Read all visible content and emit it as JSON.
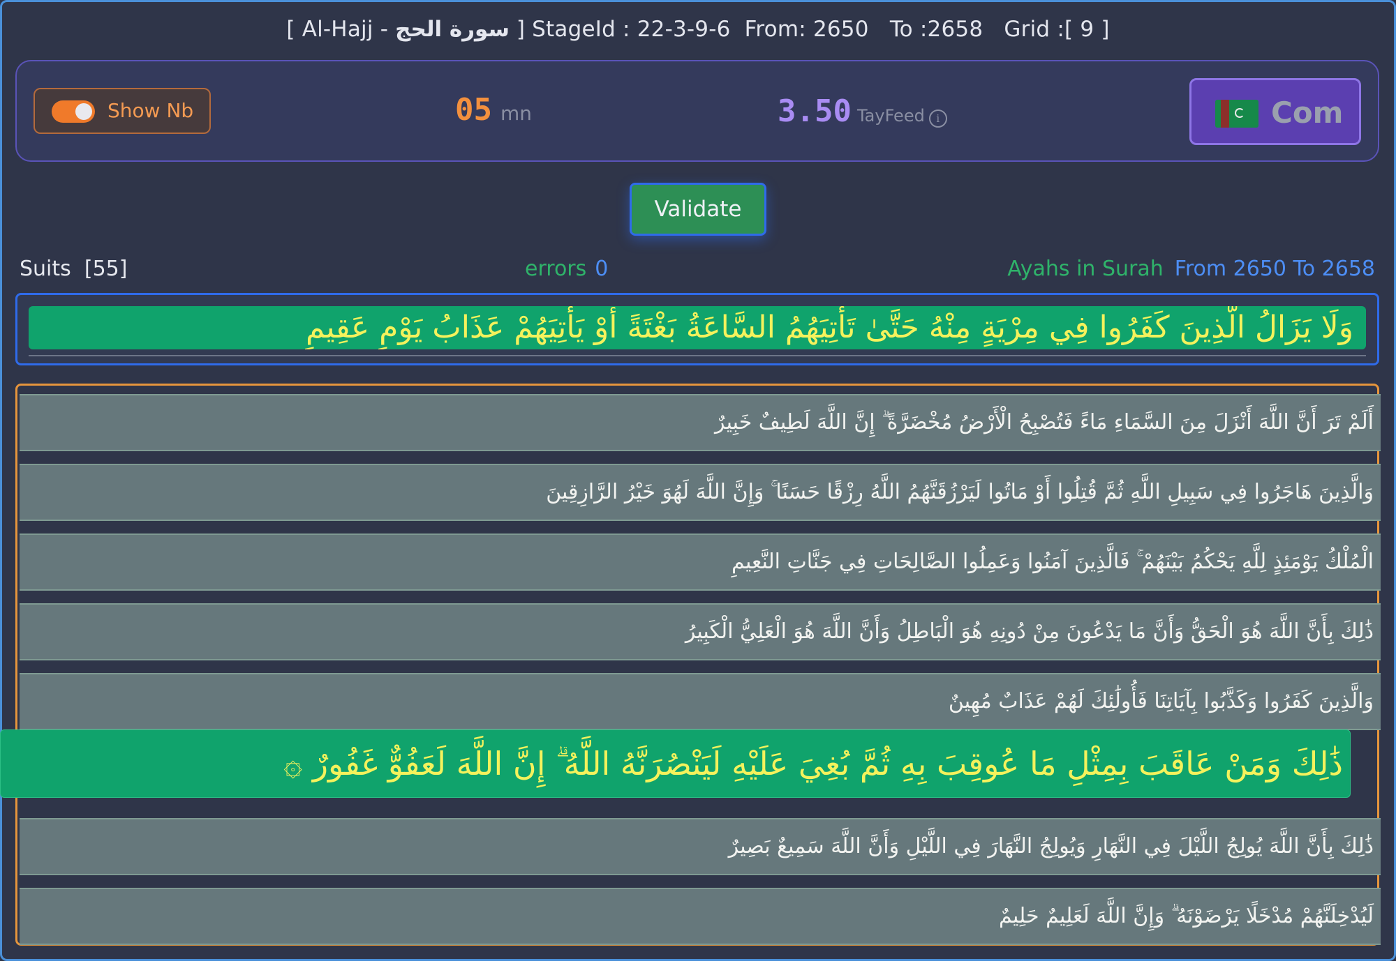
{
  "header": {
    "surah_latin": "Al-Hajj",
    "surah_arabic": "سورة الحج",
    "stage_label": "StageId :",
    "stage_id": "22-3-9-6",
    "from_label": "From:",
    "from_value": "2650",
    "to_label": "To :",
    "to_value": "2658",
    "grid_label": "Grid :[",
    "grid_value": "9"
  },
  "panel": {
    "toggle_label": "Show Nb",
    "toggle_on": true,
    "minutes_value": "05",
    "minutes_unit": "mn",
    "tayfeed_value": "3.50",
    "tayfeed_unit": "TayFeed",
    "info_icon": "i",
    "com_label": "Com",
    "flag_icon": "turkmenistan-flag-icon"
  },
  "validate_label": "Validate",
  "stats": {
    "suits_label": "Suits",
    "suits_value": "[55]",
    "errors_label": "errors",
    "errors_value": "0",
    "ayahs_label": "Ayahs in Surah",
    "ayahs_range": "From 2650 To 2658"
  },
  "active_verse": "وَلَا يَزَالُ الَّذِينَ كَفَرُوا فِي مِرْيَةٍ مِنْهُ حَتَّىٰ تَأْتِيَهُمُ السَّاعَةُ بَغْتَةً أَوْ يَأْتِيَهُمْ عَذَابُ يَوْمٍ عَقِيمٍ",
  "verses": [
    "أَلَمْ تَرَ أَنَّ اللَّهَ أَنْزَلَ مِنَ السَّمَاءِ مَاءً فَتُصْبِحُ الْأَرْضُ مُخْضَرَّةً ۗ إِنَّ اللَّهَ لَطِيفٌ خَبِيرٌ",
    "وَالَّذِينَ هَاجَرُوا فِي سَبِيلِ اللَّهِ ثُمَّ قُتِلُوا أَوْ مَاتُوا لَيَرْزُقَنَّهُمُ اللَّهُ رِزْقًا حَسَنًا ۚ وَإِنَّ اللَّهَ لَهُوَ خَيْرُ الرَّازِقِينَ",
    "الْمُلْكُ يَوْمَئِذٍ لِلَّهِ يَحْكُمُ بَيْنَهُمْ ۚ فَالَّذِينَ آمَنُوا وَعَمِلُوا الصَّالِحَاتِ فِي جَنَّاتِ النَّعِيمِ",
    "ذَٰلِكَ بِأَنَّ اللَّهَ هُوَ الْحَقُّ وَأَنَّ مَا يَدْعُونَ مِنْ دُونِهِ هُوَ الْبَاطِلُ وَأَنَّ اللَّهَ هُوَ الْعَلِيُّ الْكَبِيرُ",
    "وَالَّذِينَ كَفَرُوا وَكَذَّبُوا بِآيَاتِنَا فَأُولَٰئِكَ لَهُمْ عَذَابٌ مُهِينٌ",
    "ذَٰلِكَ بِأَنَّ اللَّهَ يُولِجُ اللَّيْلَ فِي النَّهَارِ وَيُولِجُ النَّهَارَ فِي اللَّيْلِ وَأَنَّ اللَّهَ سَمِيعٌ بَصِيرٌ",
    "لَيُدْخِلَنَّهُمْ مُدْخَلًا يَرْضَوْنَهُ ۗ وَإِنَّ اللَّهَ لَعَلِيمٌ حَلِيمٌ"
  ],
  "dragged_verse": "ذَٰلِكَ وَمَنْ عَاقَبَ بِمِثْلِ مَا عُوقِبَ بِهِ ثُمَّ بُغِيَ عَلَيْهِ لَيَنْصُرَنَّهُ اللَّهُ ۗ إِنَّ اللَّهَ لَعَفُوٌّ غَفُورٌ ۞",
  "colors": {
    "accent_blue": "#2f6bea",
    "highlight_green": "#10a36c",
    "verse_text_yellow": "#f4f25c",
    "list_border_orange": "#e6953c",
    "com_purple": "#5b3fb0"
  }
}
